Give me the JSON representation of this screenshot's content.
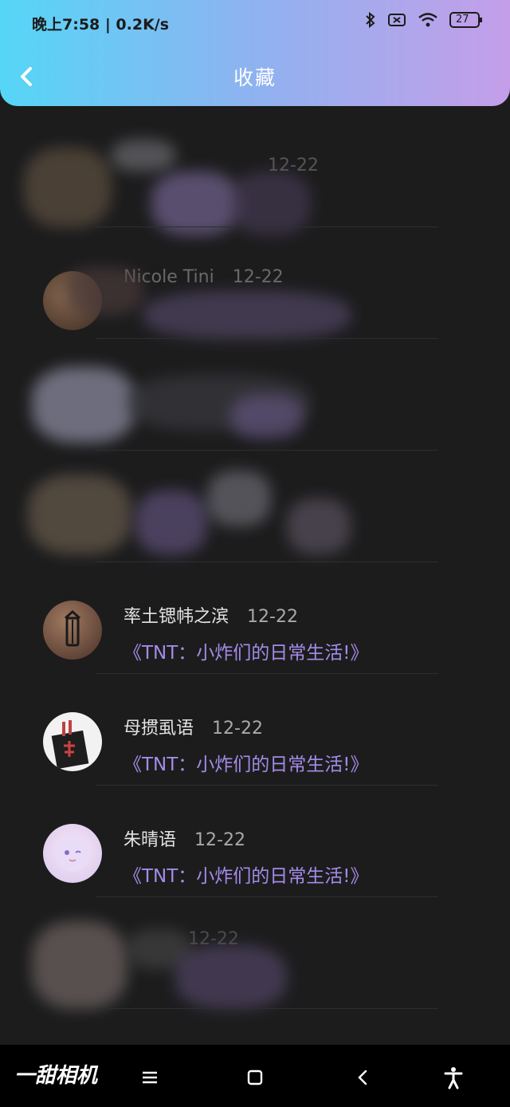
{
  "status_bar": {
    "time": "晚上7:58 | 0.2K/s",
    "battery": "27"
  },
  "header": {
    "title": "收藏"
  },
  "items": [
    {
      "name": "",
      "date": "12-22",
      "title": ""
    },
    {
      "name": "Nicole Tini",
      "date": "12-22",
      "title": ""
    },
    {
      "name": "",
      "date": "",
      "title": ""
    },
    {
      "name": "",
      "date": "",
      "title": ""
    },
    {
      "name": "率土锶帏之滨",
      "date": "12-22",
      "title": "《TNT：小炸们的日常生活!》"
    },
    {
      "name": "母掼虱语",
      "date": "12-22",
      "title": "《TNT：小炸们的日常生活!》"
    },
    {
      "name": "朱晴语",
      "date": "12-22",
      "title": "《TNT：小炸们的日常生活!》"
    },
    {
      "name": "",
      "date": "12-22",
      "title": ""
    }
  ],
  "bottom_bar": {
    "logo": "一甜相机"
  },
  "colors": {
    "background": "#1c1c1d",
    "accent_title": "#a58be8",
    "header_gradient_start": "#55d6f7",
    "header_gradient_end": "#c59ee9"
  }
}
